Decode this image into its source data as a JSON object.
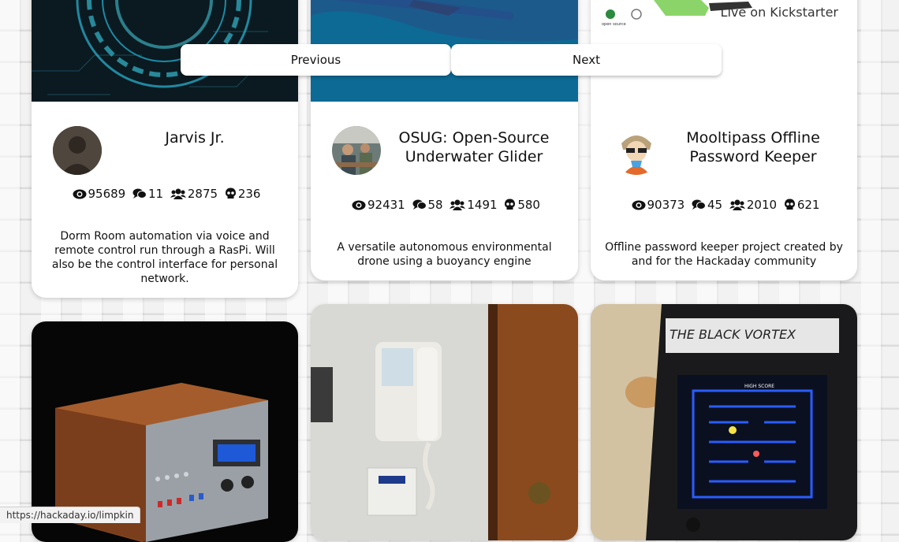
{
  "pager": {
    "previous_label": "Previous",
    "next_label": "Next"
  },
  "projects": [
    {
      "title": "Jarvis Jr.",
      "views": "95689",
      "comments": "11",
      "followers": "2875",
      "skulls": "236",
      "description": "Dorm Room automation via voice and remote control run through a RasPi. Will also be the control interface for personal network."
    },
    {
      "title": "OSUG: Open-Source Underwater Glider",
      "views": "92431",
      "comments": "58",
      "followers": "1491",
      "skulls": "580",
      "description": "A versatile autonomous environmental drone using a buoyancy engine"
    },
    {
      "title": "Mooltipass Offline Password Keeper",
      "views": "90373",
      "comments": "45",
      "followers": "2010",
      "skulls": "621",
      "description": "Offline password keeper project created by and for the Hackaday community",
      "banner_text": "Live on Kickstarter"
    }
  ],
  "bottom_cards": [
    {
      "arcade_marquee": "THE BLACK VORTEX",
      "arcade_score_label": "HIGH SCORE"
    }
  ],
  "status_bar": {
    "url": "https://hackaday.io/limpkin"
  },
  "colors": {
    "glider_blue": "#0d6a94",
    "text": "#111111",
    "card": "#ffffff"
  },
  "icons": [
    "eye-icon",
    "comments-icon",
    "users-icon",
    "skull-icon"
  ]
}
